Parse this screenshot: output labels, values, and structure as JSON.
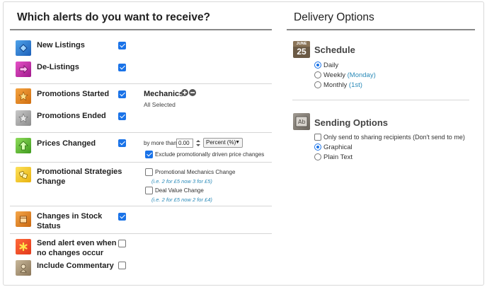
{
  "alerts": {
    "title": "Which alerts do you want to receive?",
    "items": [
      {
        "label": "New Listings",
        "checked": true
      },
      {
        "label": "De-Listings",
        "checked": true
      },
      {
        "label": "Promotions Started",
        "checked": true
      },
      {
        "label": "Promotions Ended",
        "checked": true
      },
      {
        "label": "Prices Changed",
        "checked": true
      },
      {
        "label_line1": "Promotional Strategies",
        "label_line2": "Change"
      },
      {
        "label_line1": "Changes in Stock",
        "label_line2": "Status",
        "checked": true
      },
      {
        "label_line1": "Send alert even when",
        "label_line2": "no changes occur",
        "checked": false
      },
      {
        "label": "Include Commentary",
        "checked": false
      }
    ],
    "mechanics": {
      "label": "Mechanics",
      "status": "All Selected"
    },
    "price": {
      "by_more_than": "by more than",
      "value": "0.00",
      "unit": "Percent (%)",
      "exclude_label": "Exclude promotionally driven price changes",
      "exclude_checked": true
    },
    "strategies": {
      "mechanics_change": "Promotional Mechanics Change",
      "mechanics_example": "(i.e. 2 for £5 now 3 for £5)",
      "deal_value_change": "Deal Value Change",
      "deal_value_example": "(i.e. 2 for £5 now 2 for £4)"
    }
  },
  "delivery": {
    "title": "Delivery Options",
    "calendar": {
      "month": "JUNE",
      "day": "25"
    },
    "schedule": {
      "title": "Schedule",
      "options": [
        {
          "label": "Daily",
          "note": "",
          "selected": true
        },
        {
          "label": "Weekly",
          "note": "(Monday)",
          "selected": false
        },
        {
          "label": "Monthly",
          "note": "(1st)",
          "selected": false
        }
      ]
    },
    "sending": {
      "title": "Sending Options",
      "only_sharing": "Only send to sharing recipients (Don't send to me)",
      "formats": [
        {
          "label": "Graphical",
          "selected": true
        },
        {
          "label": "Plain Text",
          "selected": false
        }
      ]
    }
  }
}
